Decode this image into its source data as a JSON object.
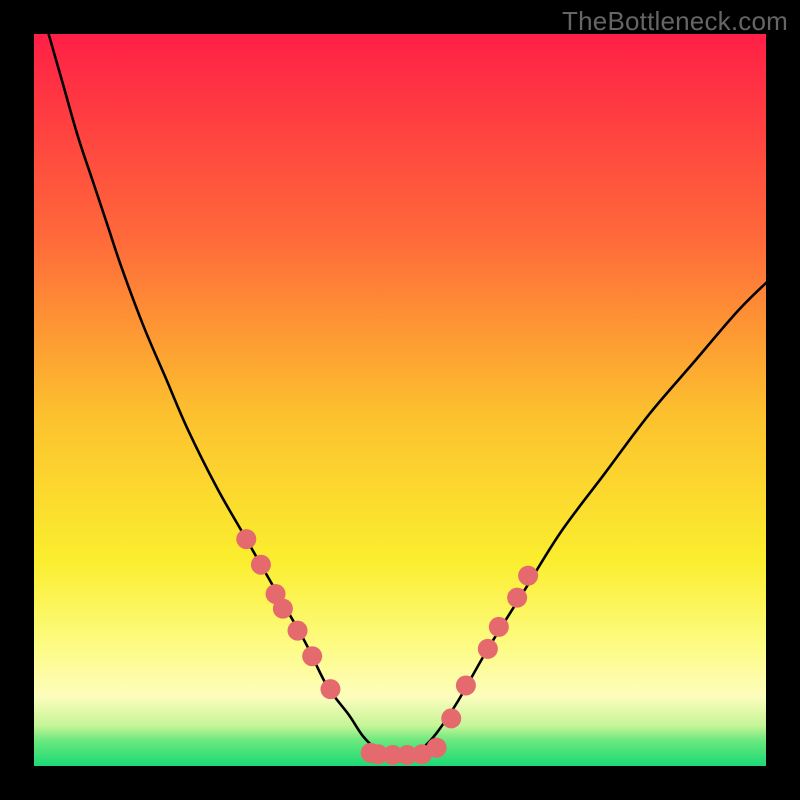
{
  "watermark": "TheBottleneck.com",
  "chart_data": {
    "type": "line",
    "title": "",
    "xlabel": "",
    "ylabel": "",
    "xlim": [
      0,
      100
    ],
    "ylim": [
      0,
      100
    ],
    "grid": false,
    "legend": false,
    "background": {
      "type": "vertical-gradient",
      "stops": [
        {
          "offset": 0.0,
          "color": "#ff1f46"
        },
        {
          "offset": 0.28,
          "color": "#ff6a3a"
        },
        {
          "offset": 0.52,
          "color": "#fcc12e"
        },
        {
          "offset": 0.72,
          "color": "#fbee2e"
        },
        {
          "offset": 0.84,
          "color": "#fdfc87"
        },
        {
          "offset": 0.905,
          "color": "#fdfdbd"
        },
        {
          "offset": 0.945,
          "color": "#c5f597"
        },
        {
          "offset": 0.965,
          "color": "#6be87e"
        },
        {
          "offset": 1.0,
          "color": "#1ad975"
        }
      ]
    },
    "series": [
      {
        "name": "bottleneck-curve",
        "type": "line",
        "color": "#000000",
        "x": [
          2,
          4,
          6,
          8,
          10,
          12,
          15,
          18,
          21,
          25,
          29,
          33,
          37,
          40,
          43,
          45,
          47,
          49,
          51,
          53,
          55,
          58,
          62,
          67,
          72,
          78,
          84,
          90,
          96,
          100
        ],
        "y": [
          100,
          93,
          86,
          80,
          74,
          68,
          60,
          53,
          46,
          38,
          31,
          24,
          17,
          11,
          7,
          4,
          2.2,
          1.6,
          1.6,
          2.4,
          4.5,
          9,
          16,
          24,
          32,
          40,
          48,
          55,
          62,
          66
        ]
      },
      {
        "name": "dot-markers",
        "type": "scatter",
        "color": "#e46a6d",
        "marker_radius": 10,
        "x": [
          29,
          31,
          33,
          34,
          36,
          38,
          40.5,
          46,
          47,
          49,
          51,
          53,
          55,
          57,
          59,
          62,
          63.5,
          66,
          67.5
        ],
        "y": [
          31,
          27.5,
          23.5,
          21.5,
          18.5,
          15,
          10.5,
          1.8,
          1.6,
          1.5,
          1.5,
          1.6,
          2.5,
          6.5,
          11,
          16,
          19,
          23,
          26
        ]
      }
    ],
    "flat_segment": {
      "note": "curve minimum flattens between roughly x=47 and x=53 near y≈1.5",
      "x_start": 47,
      "x_end": 53,
      "y": 1.5
    }
  }
}
